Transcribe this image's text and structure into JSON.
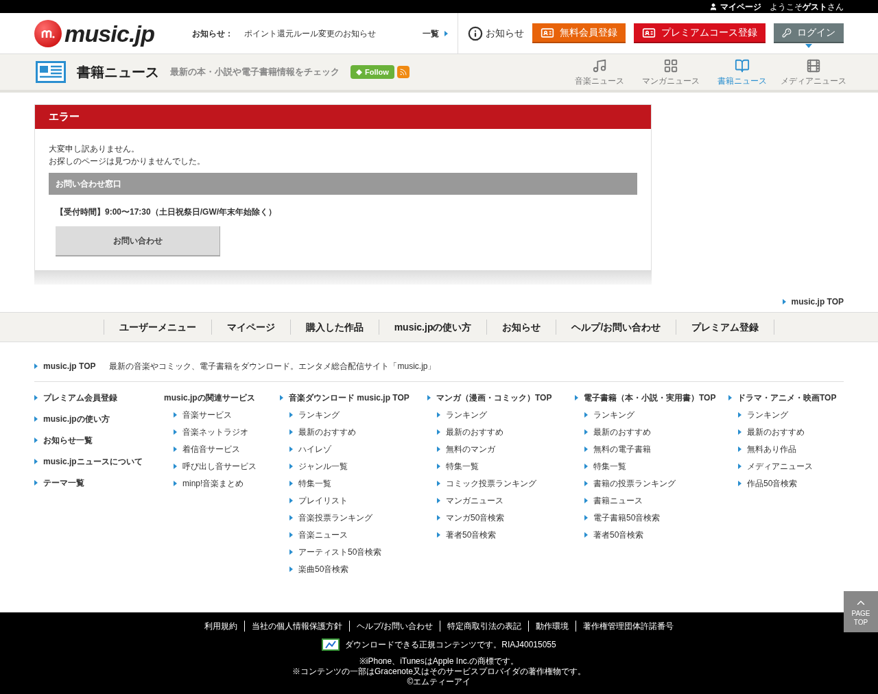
{
  "top_bar": {
    "mypage": "マイページ",
    "welcome_prefix": "ようこそ",
    "welcome_name": "ゲスト",
    "welcome_suffix": "さん"
  },
  "header": {
    "logo": "music.jp",
    "notice_label": "お知らせ：",
    "notice_text": "ポイント還元ルール変更のお知らせ",
    "list_link": "一覧",
    "info_link": "お知らせ",
    "buttons": [
      {
        "label": "無料会員登録",
        "kind": "free"
      },
      {
        "label": "プレミアムコース登録",
        "kind": "premium"
      },
      {
        "label": "ログイン",
        "kind": "login"
      }
    ]
  },
  "category_bar": {
    "title": "書籍ニュース",
    "subtitle": "最新の本・小説や電子書籍情報をチェック",
    "follow": "Follow",
    "tabs": [
      {
        "label": "音楽ニュース",
        "kind": "music",
        "selected": false
      },
      {
        "label": "マンガニュース",
        "kind": "manga",
        "selected": false
      },
      {
        "label": "書籍ニュース",
        "kind": "book",
        "selected": true
      },
      {
        "label": "メディアニュース",
        "kind": "media",
        "selected": false
      }
    ]
  },
  "error": {
    "title": "エラー",
    "lines": [
      "大変申し訳ありません。",
      "お探しのページは見つかりませんでした。"
    ],
    "contact_heading": "お問い合わせ窓口",
    "hours": "【受付時間】9:00〜17:30（土日祝祭日/GW/年末年始除く）",
    "contact_button": "お問い合わせ"
  },
  "top_link": "music.jp TOP",
  "user_nav": [
    "ユーザーメニュー",
    "マイページ",
    "購入した作品",
    "music.jpの使い方",
    "お知らせ",
    "ヘルプ/お問い合わせ",
    "プレミアム登録"
  ],
  "site_intro": {
    "link": "music.jp TOP",
    "text": "最新の音楽やコミック、電子書籍をダウンロード。エンタメ総合配信サイト「music.jp」"
  },
  "footer_left": [
    "プレミアム会員登録",
    "music.jpの使い方",
    "お知らせ一覧",
    "music.jpニュースについて",
    "テーマ一覧"
  ],
  "footer_columns": [
    {
      "title": "music.jpの関連サービス",
      "kind": "label",
      "items": [
        "音楽サービス",
        "音楽ネットラジオ",
        "着信音サービス",
        "呼び出し音サービス",
        "minp!音楽まとめ"
      ]
    },
    {
      "title": "音楽ダウンロード music.jp TOP",
      "kind": "link",
      "items": [
        "ランキング",
        "最新のおすすめ",
        "ハイレゾ",
        "ジャンル一覧",
        "特集一覧",
        "プレイリスト",
        "音楽投票ランキング",
        "音楽ニュース",
        "アーティスト50音検索",
        "楽曲50音検索"
      ]
    },
    {
      "title": "マンガ（漫画・コミック）TOP",
      "kind": "link",
      "items": [
        "ランキング",
        "最新のおすすめ",
        "無料のマンガ",
        "特集一覧",
        "コミック投票ランキング",
        "マンガニュース",
        "マンガ50音検索",
        "著者50音検索"
      ]
    },
    {
      "title": "電子書籍（本・小説・実用書）TOP",
      "kind": "link",
      "items": [
        "ランキング",
        "最新のおすすめ",
        "無料の電子書籍",
        "特集一覧",
        "書籍の投票ランキング",
        "書籍ニュース",
        "電子書籍50音検索",
        "著者50音検索"
      ]
    },
    {
      "title": "ドラマ・アニメ・映画TOP",
      "kind": "link",
      "items": [
        "ランキング",
        "最新のおすすめ",
        "無料あり作品",
        "メディアニュース",
        "作品50音検索"
      ]
    }
  ],
  "footer": {
    "links": [
      "利用規約",
      "当社の個人情報保護方針",
      "ヘルプ/お問い合わせ",
      "特定商取引法の表記",
      "動作環境",
      "著作権管理団体許諾番号"
    ],
    "riaj": "ダウンロードできる正規コンテンツです。RIAJ40015055",
    "notes": [
      "※iPhone、iTunesはApple Inc.の商標です。",
      "※コンテンツの一部はGracenote又はそのサービスプロバイダの著作権物です。",
      "©エムティーアイ"
    ]
  },
  "page_top": [
    "PAGE",
    "TOP"
  ]
}
